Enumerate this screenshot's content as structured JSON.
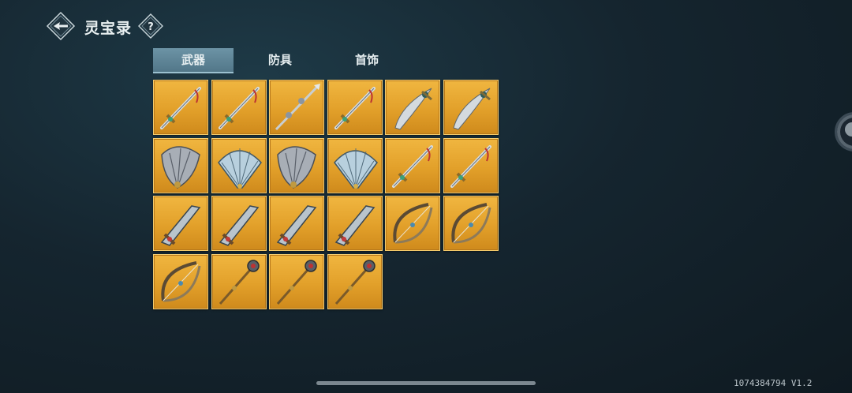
{
  "header": {
    "title": "灵宝录",
    "back_icon": "back-arrow-icon",
    "help_icon": "help-question-icon"
  },
  "tabs": [
    {
      "label": "武器",
      "active": true
    },
    {
      "label": "防具",
      "active": false
    },
    {
      "label": "首饰",
      "active": false
    }
  ],
  "items": [
    {
      "icon": "sword-icon"
    },
    {
      "icon": "sword-icon"
    },
    {
      "icon": "spear-icon"
    },
    {
      "icon": "sword-icon"
    },
    {
      "icon": "curved-blade-icon"
    },
    {
      "icon": "curved-blade-icon"
    },
    {
      "icon": "feather-fan-icon"
    },
    {
      "icon": "folding-fan-icon"
    },
    {
      "icon": "feather-fan-icon"
    },
    {
      "icon": "folding-fan-icon"
    },
    {
      "icon": "sword-icon"
    },
    {
      "icon": "sword-icon"
    },
    {
      "icon": "broadsword-icon"
    },
    {
      "icon": "broadsword-icon"
    },
    {
      "icon": "broadsword-icon"
    },
    {
      "icon": "broadsword-icon"
    },
    {
      "icon": "bow-icon"
    },
    {
      "icon": "bow-icon"
    },
    {
      "icon": "bow-icon"
    },
    {
      "icon": "staff-icon"
    },
    {
      "icon": "staff-icon"
    },
    {
      "icon": "staff-icon"
    }
  ],
  "footer": {
    "version": "1074384794 V1.2"
  },
  "colors": {
    "item_background": "#e2a02a",
    "active_tab": "#6c93a5",
    "page_background": "#15252f"
  }
}
